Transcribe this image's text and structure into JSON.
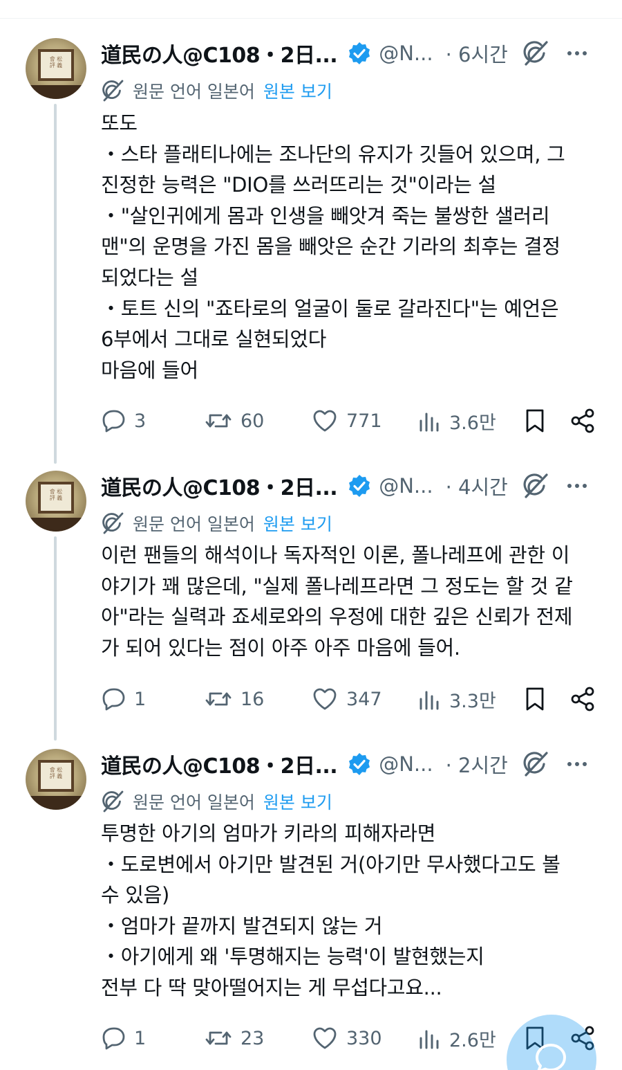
{
  "tweets": [
    {
      "author": {
        "name": "道民の人@C108・2日...",
        "handle": "@N...",
        "avatar_text": "會 松 評 義"
      },
      "time": "· 6시간",
      "translation": {
        "label": "원문 언어 일본어",
        "link": "원본 보기"
      },
      "body_lines": [
        "또도",
        "・스타 플래티나에는 조나단의 유지가 깃들어 있으며, 그",
        "진정한 능력은 \"DIO를 쓰러뜨리는 것\"이라는 설",
        "・\"살인귀에게 몸과 인생을 빼앗겨 죽는 불쌍한 샐러리",
        "맨\"의 운명을 가진 몸을 빼앗은 순간 기라의 최후는 결정",
        "되었다는 설",
        "・토트 신의 \"죠타로의 얼굴이 둘로 갈라진다\"는 예언은",
        "6부에서 그대로 실현되었다",
        "마음에 들어"
      ],
      "stats": {
        "replies": "3",
        "reposts": "60",
        "likes": "771",
        "views": "3.6만"
      }
    },
    {
      "author": {
        "name": "道民の人@C108・2日...",
        "handle": "@N...",
        "avatar_text": "會 松 評 義"
      },
      "time": "· 4시간",
      "translation": {
        "label": "원문 언어 일본어",
        "link": "원본 보기"
      },
      "body_lines": [
        "이런 팬들의 해석이나 독자적인 이론, 폴나레프에 관한 이",
        "야기가 꽤 많은데, \"실제 폴나레프라면 그 정도는 할 것 같",
        "아\"라는 실력과 죠세로와의 우정에 대한 깊은 신뢰가 전제",
        "가 되어 있다는 점이 아주 아주 마음에 들어."
      ],
      "stats": {
        "replies": "1",
        "reposts": "16",
        "likes": "347",
        "views": "3.3만"
      }
    },
    {
      "author": {
        "name": "道民の人@C108・2日...",
        "handle": "@N...",
        "avatar_text": "會 松 評 義"
      },
      "time": "· 2시간",
      "translation": {
        "label": "원문 언어 일본어",
        "link": "원본 보기"
      },
      "body_lines": [
        "투명한 아기의 엄마가 키라의 피해자라면",
        "・도로변에서 아기만 발견된 거(아기만 무사했다고도 볼",
        "수 있음)",
        "・엄마가 끝까지 발견되지 않는 거",
        "・아기에게 왜 '투명해지는 능력'이 발현했는지",
        "전부 다 딱 맞아떨어지는 게 무섭다고요..."
      ],
      "stats": {
        "replies": "1",
        "reposts": "23",
        "likes": "330",
        "views": "2.6만"
      }
    }
  ],
  "colors": {
    "accent": "#1d9bf0",
    "muted": "#536471",
    "text": "#0f1419",
    "thread_line": "#cfd9de"
  },
  "icons": [
    "verified-badge-icon",
    "grok-icon",
    "more-icon",
    "translate-icon",
    "reply-icon",
    "repost-icon",
    "like-icon",
    "views-icon",
    "bookmark-icon",
    "share-icon",
    "compose-reply-icon"
  ]
}
